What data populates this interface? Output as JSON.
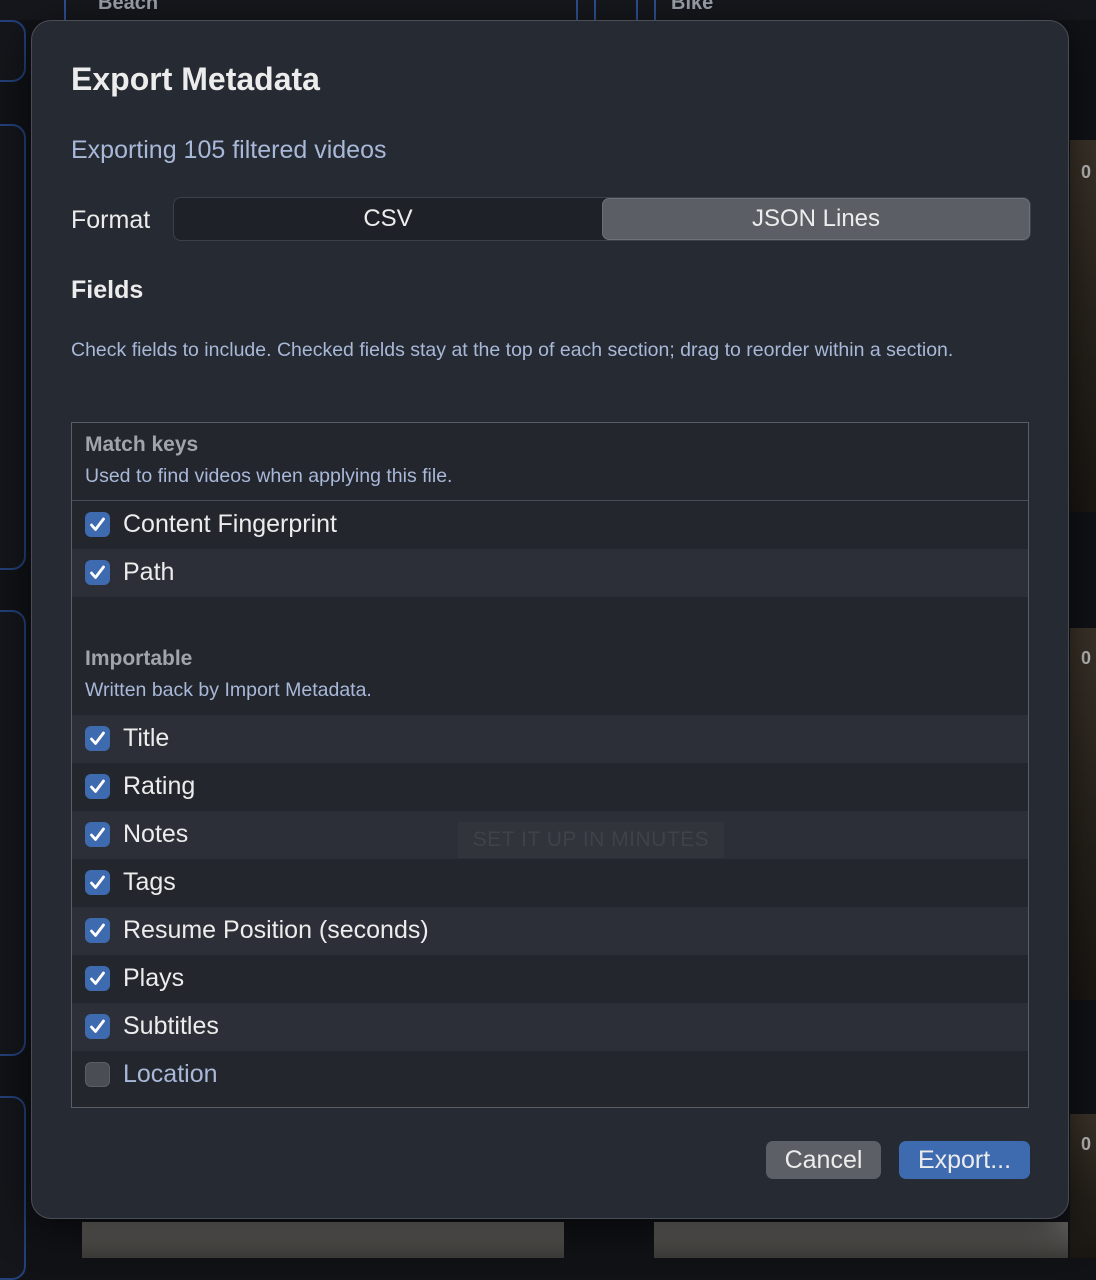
{
  "background": {
    "cards": [
      "Beach",
      "Bike"
    ],
    "times": [
      "0",
      "0",
      "0"
    ]
  },
  "dialog": {
    "title": "Export Metadata",
    "subtitle": "Exporting 105 filtered videos",
    "format": {
      "label": "Format",
      "options": [
        "CSV",
        "JSON Lines"
      ],
      "selected": "JSON Lines"
    },
    "fields": {
      "title": "Fields",
      "help": "Check fields to include. Checked fields stay at the top of each section; drag to reorder within a section."
    },
    "sections": [
      {
        "title": "Match keys",
        "description": "Used to find videos when applying this file.",
        "items": [
          {
            "label": "Content Fingerprint",
            "checked": true
          },
          {
            "label": "Path",
            "checked": true
          }
        ]
      },
      {
        "title": "Importable",
        "description": "Written back by Import Metadata.",
        "items": [
          {
            "label": "Title",
            "checked": true
          },
          {
            "label": "Rating",
            "checked": true
          },
          {
            "label": "Notes",
            "checked": true
          },
          {
            "label": "Tags",
            "checked": true
          },
          {
            "label": "Resume Position (seconds)",
            "checked": true
          },
          {
            "label": "Plays",
            "checked": true
          },
          {
            "label": "Subtitles",
            "checked": true
          },
          {
            "label": "Location",
            "checked": false
          }
        ]
      }
    ],
    "watermark": "SET IT UP IN MINUTES",
    "buttons": {
      "cancel": "Cancel",
      "export": "Export..."
    }
  },
  "colors": {
    "accent": "#3e6bb0",
    "dialog_bg": "#262a32",
    "secondary_text": "#a8b8d8"
  }
}
